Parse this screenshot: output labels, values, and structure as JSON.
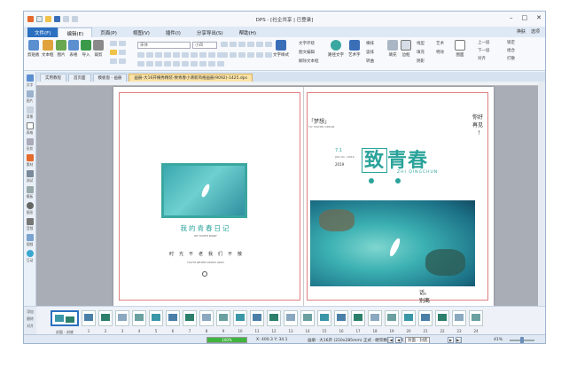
{
  "window": {
    "title": "DPS - [社企共享 | 已登录]",
    "minimize": "–",
    "maximize": "□",
    "close": "✕"
  },
  "menu": {
    "file": "文件(F)",
    "items": [
      "编辑(E)",
      "页面(P)",
      "视图(V)",
      "插件(I)",
      "分享导出(S)",
      "帮助(H)"
    ],
    "active_index": 0,
    "right": [
      "换肤",
      "选项"
    ]
  },
  "ribbon": {
    "groups": [
      {
        "label": "剪贴板",
        "color": "#5b8fd0"
      },
      {
        "label": "文本框",
        "color": "#e0a23c"
      },
      {
        "label": "图片",
        "color": "#6aa84f"
      },
      {
        "label": "表格",
        "color": "#5b8fd0"
      },
      {
        "label": "导入",
        "color": "#3a9a4a"
      },
      {
        "label": "裁剪",
        "color": "#8a8a8a"
      }
    ],
    "font_name": "宋体",
    "font_size": "小四",
    "text_style_label": "文字样式",
    "text_options": [
      "文字环绕",
      "图文编辑",
      "解除文本框"
    ],
    "wrap_label": "路径文字",
    "art_label": "艺术字",
    "right_options": [
      "横排",
      "竖排",
      "转曲",
      "线型",
      "填充",
      "艺术",
      "特效"
    ],
    "layer_options": [
      "上一层",
      "下一层",
      "对齐",
      "锁定",
      "组合",
      "打散"
    ],
    "fill_label": "填充",
    "border_label": "边框",
    "shadow_label": "阴影",
    "image_label": "图面"
  },
  "tabs": [
    {
      "label": "实用教程",
      "active": false
    },
    {
      "label": "首页面",
      "active": false
    },
    {
      "label": "模板窗 - 画册",
      "active": false
    },
    {
      "label": "画册-大16开横秀精装-致青春小清新风格画册(9092)-1425.dps",
      "active": true
    }
  ],
  "left_tools": [
    "文字",
    "图片",
    "背景",
    "表格",
    "形状",
    "素材",
    "测试",
    "模板",
    "图形",
    "音频",
    "视频",
    "互动"
  ],
  "spread": {
    "left": {
      "title": "我的青春日记",
      "subtitle": "MY YOUTH DIARY",
      "line": "时光不老我们不散",
      "line_en": "YOUTH NEVER DROPS AWAY"
    },
    "right": {
      "tag": "「梦想」",
      "tag_sub": "FLY HIGHER DREAM",
      "corner_lines": [
        "你好",
        "再见",
        "！"
      ],
      "date_num": "7.1",
      "date_text": "JULY 01 / 2019",
      "year": "2019",
      "title_boxed": "致",
      "title_rest": "青春",
      "pinyin": "ZHI QINGCHUN",
      "bottom_lines": [
        "话。",
        "别离"
      ]
    }
  },
  "page_strip": {
    "label_add": "添加",
    "label_del": "删除",
    "label_spread": "对开",
    "thumbs": [
      {
        "label": "封面 - 封底",
        "selected": true
      },
      {
        "label": "1",
        "selected": false
      },
      {
        "label": "2",
        "selected": false
      },
      {
        "label": "3",
        "selected": false
      },
      {
        "label": "4",
        "selected": false
      },
      {
        "label": "5",
        "selected": false
      },
      {
        "label": "6",
        "selected": false
      },
      {
        "label": "7",
        "selected": false
      },
      {
        "label": "8",
        "selected": false
      },
      {
        "label": "9",
        "selected": false
      },
      {
        "label": "10",
        "selected": false
      },
      {
        "label": "11",
        "selected": false
      },
      {
        "label": "12",
        "selected": false
      },
      {
        "label": "13",
        "selected": false
      },
      {
        "label": "14",
        "selected": false
      },
      {
        "label": "15",
        "selected": false
      },
      {
        "label": "16",
        "selected": false
      },
      {
        "label": "17",
        "selected": false
      },
      {
        "label": "18",
        "selected": false
      },
      {
        "label": "19",
        "selected": false
      },
      {
        "label": "20",
        "selected": false
      },
      {
        "label": "21",
        "selected": false
      },
      {
        "label": "22",
        "selected": false
      },
      {
        "label": "23",
        "selected": false
      },
      {
        "label": "24",
        "selected": false
      }
    ]
  },
  "status": {
    "progress_pct": 100,
    "progress_label": "100%",
    "coords": "X: 400.3  Y: 34.1",
    "doc_info": "画册 · 大16开 (210x285mm) 正式 · 硬壳精装 · 24页",
    "page_select": "封面 - 封底",
    "zoom": "41%"
  },
  "colors": {
    "accent": "#2aa39a",
    "brand": "#2b6fc0"
  }
}
